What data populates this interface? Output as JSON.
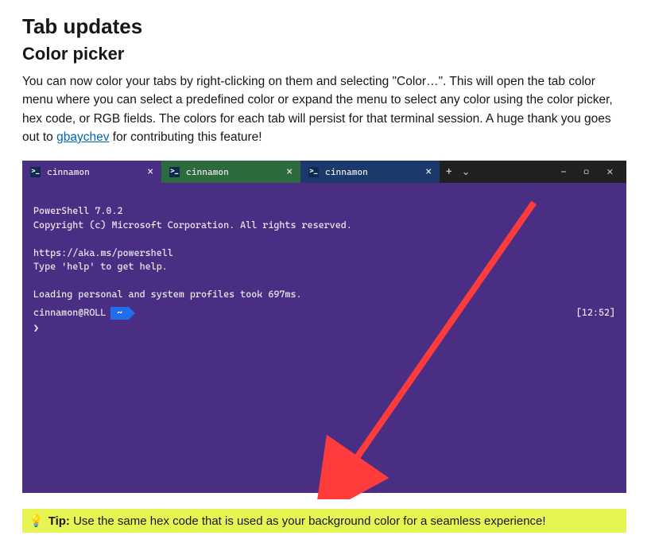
{
  "headings": {
    "h1": "Tab updates",
    "h2": "Color picker"
  },
  "paragraph": {
    "pre": "You can now color your tabs by right-clicking on them and selecting \"Color…\". This will open the tab color menu where you can select a predefined color or expand the menu to select any color using the color picker, hex code, or RGB fields. The colors for each tab will persist for that terminal session. A huge thank you goes out to ",
    "link": "gbaychev",
    "post": " for contributing this feature!"
  },
  "terminal": {
    "tabs": {
      "t0": "cinnamon",
      "t1": "cinnamon",
      "t2": "cinnamon"
    },
    "plus": "+",
    "chevron": "⌄",
    "min": "—",
    "max": "▢",
    "close": "✕",
    "lines": {
      "l0": "PowerShell 7.0.2",
      "l1": "Copyright (c) Microsoft Corporation. All rights reserved.",
      "l2": "",
      "l3": "https://aka.ms/powershell",
      "l4": "Type 'help' to get help.",
      "l5": "",
      "l6": "Loading personal and system profiles took 697ms."
    },
    "prompt_host": "cinnamon@ROLL",
    "prompt_arrow": "~",
    "prompt_time": "[12:52]",
    "prompt_caret": "❯ "
  },
  "tip": {
    "label": "Tip:",
    "text": " Use the same hex code that is used as your background color for a seamless experience!"
  },
  "colors": {
    "terminal_bg": "#4a2e84",
    "tab_green": "#2d6a3e",
    "tab_blue": "#1b3a6b",
    "arrow": "#ff3b3b",
    "highlight": "#e6f552"
  }
}
